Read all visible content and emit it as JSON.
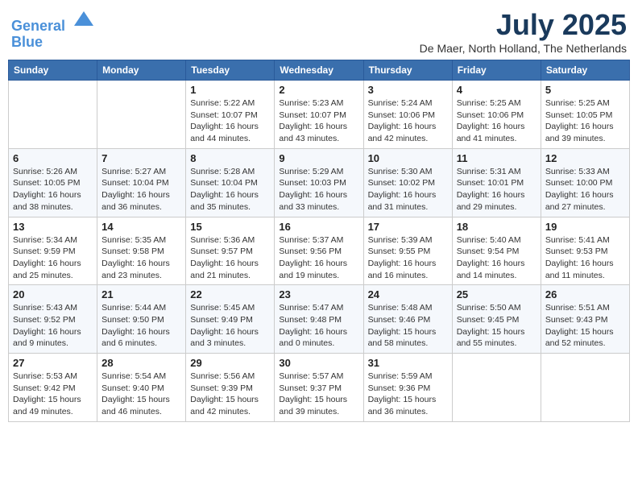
{
  "logo": {
    "line1": "General",
    "line2": "Blue"
  },
  "title": "July 2025",
  "location": "De Maer, North Holland, The Netherlands",
  "weekdays": [
    "Sunday",
    "Monday",
    "Tuesday",
    "Wednesday",
    "Thursday",
    "Friday",
    "Saturday"
  ],
  "weeks": [
    [
      {
        "day": "",
        "info": ""
      },
      {
        "day": "",
        "info": ""
      },
      {
        "day": "1",
        "info": "Sunrise: 5:22 AM\nSunset: 10:07 PM\nDaylight: 16 hours\nand 44 minutes."
      },
      {
        "day": "2",
        "info": "Sunrise: 5:23 AM\nSunset: 10:07 PM\nDaylight: 16 hours\nand 43 minutes."
      },
      {
        "day": "3",
        "info": "Sunrise: 5:24 AM\nSunset: 10:06 PM\nDaylight: 16 hours\nand 42 minutes."
      },
      {
        "day": "4",
        "info": "Sunrise: 5:25 AM\nSunset: 10:06 PM\nDaylight: 16 hours\nand 41 minutes."
      },
      {
        "day": "5",
        "info": "Sunrise: 5:25 AM\nSunset: 10:05 PM\nDaylight: 16 hours\nand 39 minutes."
      }
    ],
    [
      {
        "day": "6",
        "info": "Sunrise: 5:26 AM\nSunset: 10:05 PM\nDaylight: 16 hours\nand 38 minutes."
      },
      {
        "day": "7",
        "info": "Sunrise: 5:27 AM\nSunset: 10:04 PM\nDaylight: 16 hours\nand 36 minutes."
      },
      {
        "day": "8",
        "info": "Sunrise: 5:28 AM\nSunset: 10:04 PM\nDaylight: 16 hours\nand 35 minutes."
      },
      {
        "day": "9",
        "info": "Sunrise: 5:29 AM\nSunset: 10:03 PM\nDaylight: 16 hours\nand 33 minutes."
      },
      {
        "day": "10",
        "info": "Sunrise: 5:30 AM\nSunset: 10:02 PM\nDaylight: 16 hours\nand 31 minutes."
      },
      {
        "day": "11",
        "info": "Sunrise: 5:31 AM\nSunset: 10:01 PM\nDaylight: 16 hours\nand 29 minutes."
      },
      {
        "day": "12",
        "info": "Sunrise: 5:33 AM\nSunset: 10:00 PM\nDaylight: 16 hours\nand 27 minutes."
      }
    ],
    [
      {
        "day": "13",
        "info": "Sunrise: 5:34 AM\nSunset: 9:59 PM\nDaylight: 16 hours\nand 25 minutes."
      },
      {
        "day": "14",
        "info": "Sunrise: 5:35 AM\nSunset: 9:58 PM\nDaylight: 16 hours\nand 23 minutes."
      },
      {
        "day": "15",
        "info": "Sunrise: 5:36 AM\nSunset: 9:57 PM\nDaylight: 16 hours\nand 21 minutes."
      },
      {
        "day": "16",
        "info": "Sunrise: 5:37 AM\nSunset: 9:56 PM\nDaylight: 16 hours\nand 19 minutes."
      },
      {
        "day": "17",
        "info": "Sunrise: 5:39 AM\nSunset: 9:55 PM\nDaylight: 16 hours\nand 16 minutes."
      },
      {
        "day": "18",
        "info": "Sunrise: 5:40 AM\nSunset: 9:54 PM\nDaylight: 16 hours\nand 14 minutes."
      },
      {
        "day": "19",
        "info": "Sunrise: 5:41 AM\nSunset: 9:53 PM\nDaylight: 16 hours\nand 11 minutes."
      }
    ],
    [
      {
        "day": "20",
        "info": "Sunrise: 5:43 AM\nSunset: 9:52 PM\nDaylight: 16 hours\nand 9 minutes."
      },
      {
        "day": "21",
        "info": "Sunrise: 5:44 AM\nSunset: 9:50 PM\nDaylight: 16 hours\nand 6 minutes."
      },
      {
        "day": "22",
        "info": "Sunrise: 5:45 AM\nSunset: 9:49 PM\nDaylight: 16 hours\nand 3 minutes."
      },
      {
        "day": "23",
        "info": "Sunrise: 5:47 AM\nSunset: 9:48 PM\nDaylight: 16 hours\nand 0 minutes."
      },
      {
        "day": "24",
        "info": "Sunrise: 5:48 AM\nSunset: 9:46 PM\nDaylight: 15 hours\nand 58 minutes."
      },
      {
        "day": "25",
        "info": "Sunrise: 5:50 AM\nSunset: 9:45 PM\nDaylight: 15 hours\nand 55 minutes."
      },
      {
        "day": "26",
        "info": "Sunrise: 5:51 AM\nSunset: 9:43 PM\nDaylight: 15 hours\nand 52 minutes."
      }
    ],
    [
      {
        "day": "27",
        "info": "Sunrise: 5:53 AM\nSunset: 9:42 PM\nDaylight: 15 hours\nand 49 minutes."
      },
      {
        "day": "28",
        "info": "Sunrise: 5:54 AM\nSunset: 9:40 PM\nDaylight: 15 hours\nand 46 minutes."
      },
      {
        "day": "29",
        "info": "Sunrise: 5:56 AM\nSunset: 9:39 PM\nDaylight: 15 hours\nand 42 minutes."
      },
      {
        "day": "30",
        "info": "Sunrise: 5:57 AM\nSunset: 9:37 PM\nDaylight: 15 hours\nand 39 minutes."
      },
      {
        "day": "31",
        "info": "Sunrise: 5:59 AM\nSunset: 9:36 PM\nDaylight: 15 hours\nand 36 minutes."
      },
      {
        "day": "",
        "info": ""
      },
      {
        "day": "",
        "info": ""
      }
    ]
  ]
}
